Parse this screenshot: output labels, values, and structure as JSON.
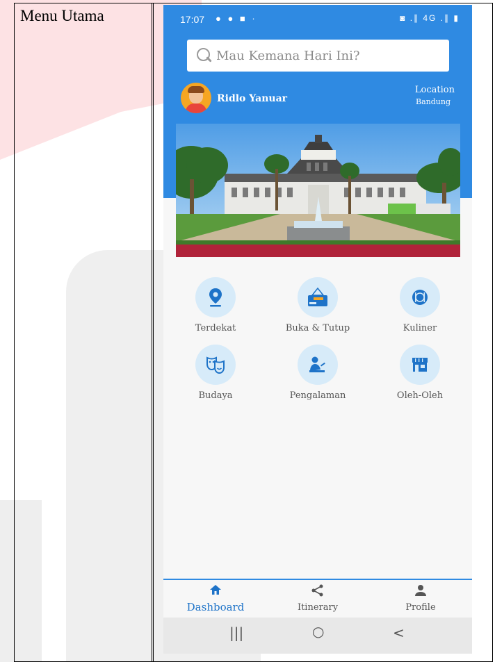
{
  "caption": "Menu Utama",
  "status_bar": {
    "time": "17:07",
    "left_icons": "● ● ■ ·",
    "right_icons": "◙ .∥ 4G .∥ ▮"
  },
  "search": {
    "placeholder": "Mau Kemana Hari Ini?"
  },
  "user": {
    "name": "Ridlo Yanuar"
  },
  "location": {
    "label": "Location",
    "city": "Bandung"
  },
  "categories": [
    {
      "label": "Terdekat",
      "icon": "location-pin-icon"
    },
    {
      "label": "Buka & Tutup",
      "icon": "open-closed-sign-icon"
    },
    {
      "label": "Kuliner",
      "icon": "plate-cutlery-icon"
    },
    {
      "label": "Budaya",
      "icon": "theater-masks-icon"
    },
    {
      "label": "Pengalaman",
      "icon": "person-desk-icon"
    },
    {
      "label": "Oleh-Oleh",
      "icon": "store-icon"
    }
  ],
  "bottom_nav": [
    {
      "label": "Dashboard",
      "icon": "home-icon",
      "active": true
    },
    {
      "label": "Itinerary",
      "icon": "share-icon",
      "active": false
    },
    {
      "label": "Profile",
      "icon": "person-icon",
      "active": false
    }
  ],
  "system_nav": {
    "recents": "|||",
    "home": "○",
    "back": "<"
  },
  "colors": {
    "primary": "#2f8ae2",
    "icon_bg": "#d7ebf9",
    "icon_fg": "#1e73c8"
  }
}
